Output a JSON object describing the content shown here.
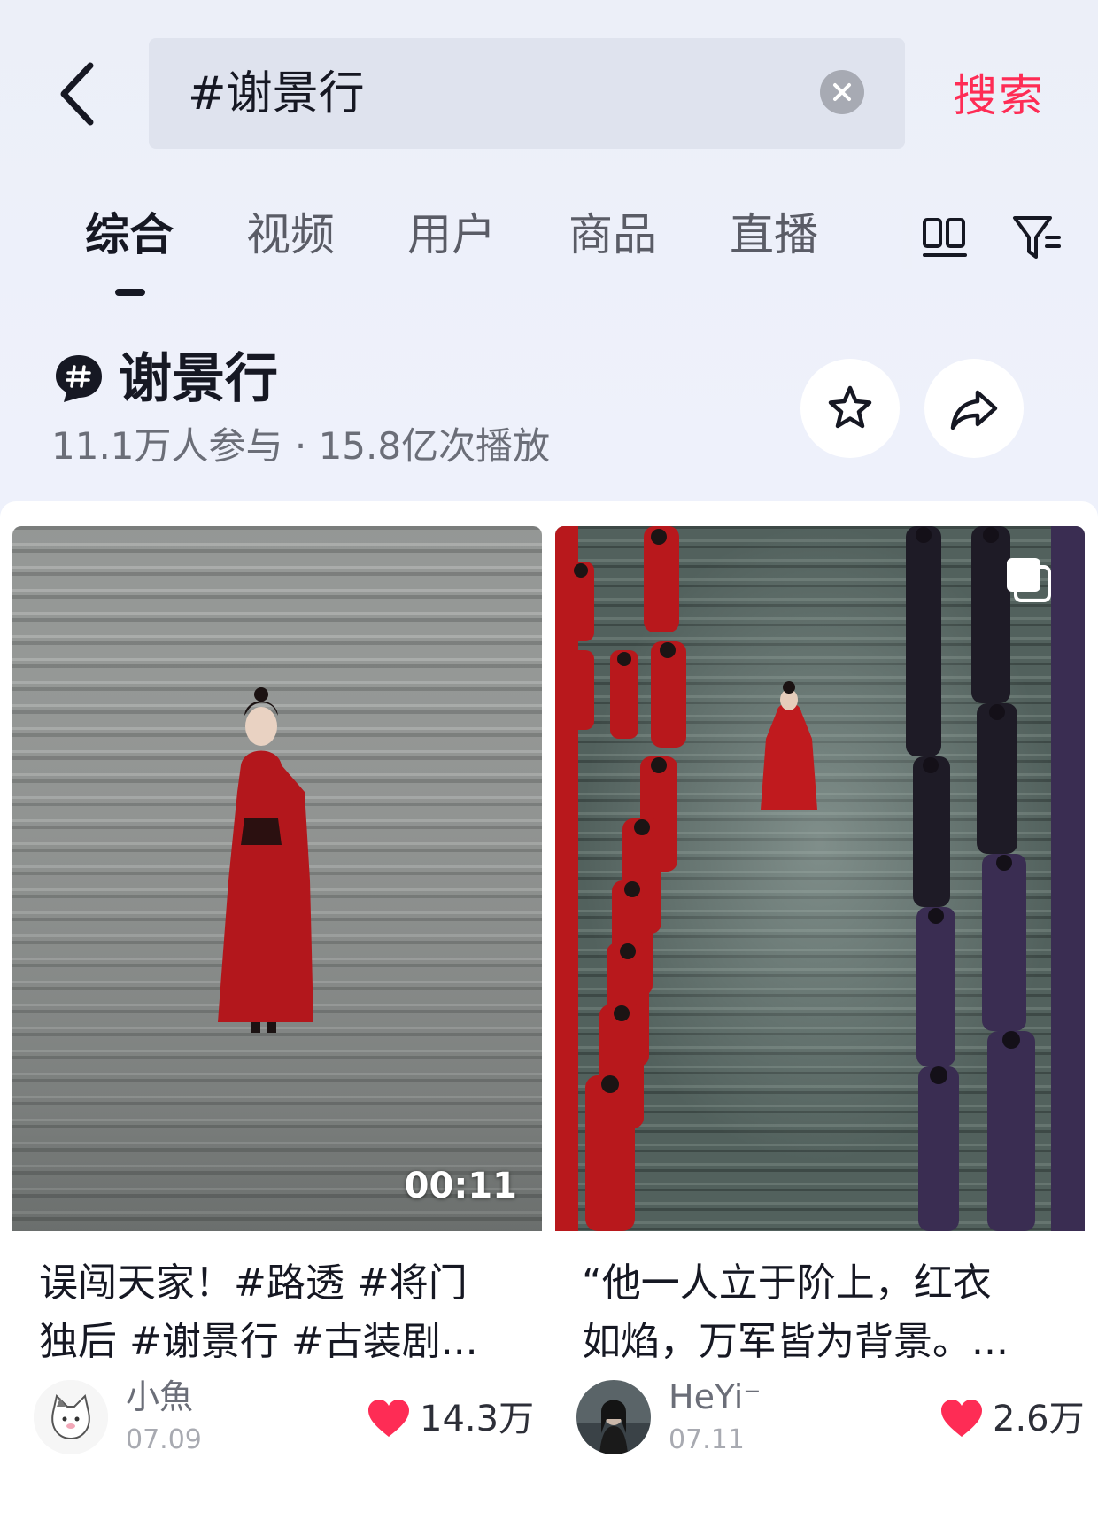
{
  "search": {
    "query": "#谢景行",
    "submit_label": "搜索"
  },
  "tabs": [
    {
      "label": "综合",
      "active": true
    },
    {
      "label": "视频",
      "active": false
    },
    {
      "label": "用户",
      "active": false
    },
    {
      "label": "商品",
      "active": false
    },
    {
      "label": "直播",
      "active": false
    }
  ],
  "topic": {
    "title": "谢景行",
    "stats": "11.1万人参与 · 15.8亿次播放"
  },
  "icons": {
    "back": "chevron-left-icon",
    "clear": "clear-icon",
    "grid": "two-column-grid-icon",
    "filter": "filter-icon",
    "hashtag": "hashtag-icon",
    "favorite": "star-icon",
    "share": "share-icon",
    "like": "heart-icon",
    "multi_image": "multi-image-icon"
  },
  "colors": {
    "accent": "#fe2c55",
    "like_heart": "#fe2c55",
    "background": "#eef1fb"
  },
  "cards": [
    {
      "duration": "00:11",
      "caption_line1": "误闯天家！#路透 #将门",
      "caption_line2": "独后 #谢景行 #古装剧...",
      "author": "小魚",
      "date": "07.09",
      "likes": "14.3万"
    },
    {
      "caption_line1": "“他一人立于阶上，红衣",
      "caption_line2": "如焰，万军皆为背景。...",
      "author": "HeYi⁻",
      "date": "07.11",
      "likes": "2.6万"
    }
  ]
}
